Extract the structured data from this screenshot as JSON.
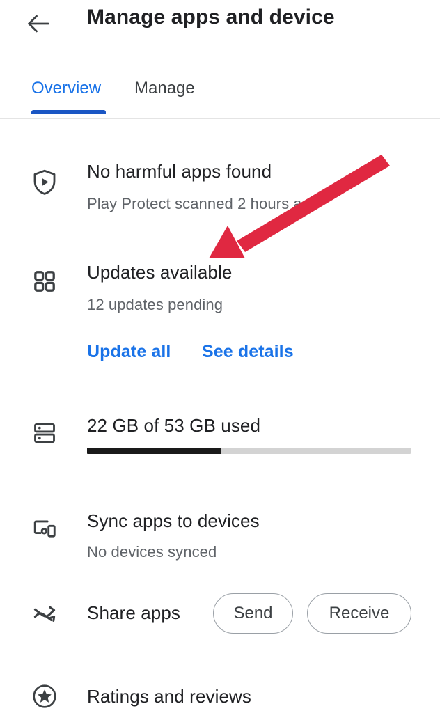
{
  "appbar": {
    "back_icon": "arrow-left-icon",
    "title": "Manage apps and device"
  },
  "tabs": {
    "items": [
      {
        "label": "Overview",
        "selected": true
      },
      {
        "label": "Manage",
        "selected": false
      }
    ],
    "active_color": "#1a73e8",
    "indicator_color": "#1a56c4"
  },
  "sections": {
    "play_protect": {
      "icon": "shield-play-icon",
      "title": "No harmful apps found",
      "subtitle": "Play Protect scanned 2 hours ago"
    },
    "updates": {
      "icon": "grid-apps-icon",
      "title": "Updates available",
      "subtitle": "12 updates pending",
      "actions": [
        {
          "label": "Update all"
        },
        {
          "label": "See details"
        }
      ]
    },
    "storage": {
      "icon": "storage-icon",
      "title": "22 GB of 53 GB used",
      "used_gb": 22,
      "total_gb": 53,
      "fill_percent": 41.5,
      "fill_color": "#1a1a1a",
      "track_color": "#d3d3d3"
    },
    "sync": {
      "icon": "devices-sync-icon",
      "title": "Sync apps to devices",
      "subtitle": "No devices synced"
    },
    "share": {
      "icon": "share-shuffle-icon",
      "title": "Share apps",
      "buttons": [
        {
          "label": "Send"
        },
        {
          "label": "Receive"
        }
      ]
    },
    "ratings": {
      "icon": "star-circle-icon",
      "title": "Ratings and reviews"
    }
  },
  "annotation": {
    "type": "arrow",
    "color": "#e02841",
    "points_to": "Updates available"
  }
}
